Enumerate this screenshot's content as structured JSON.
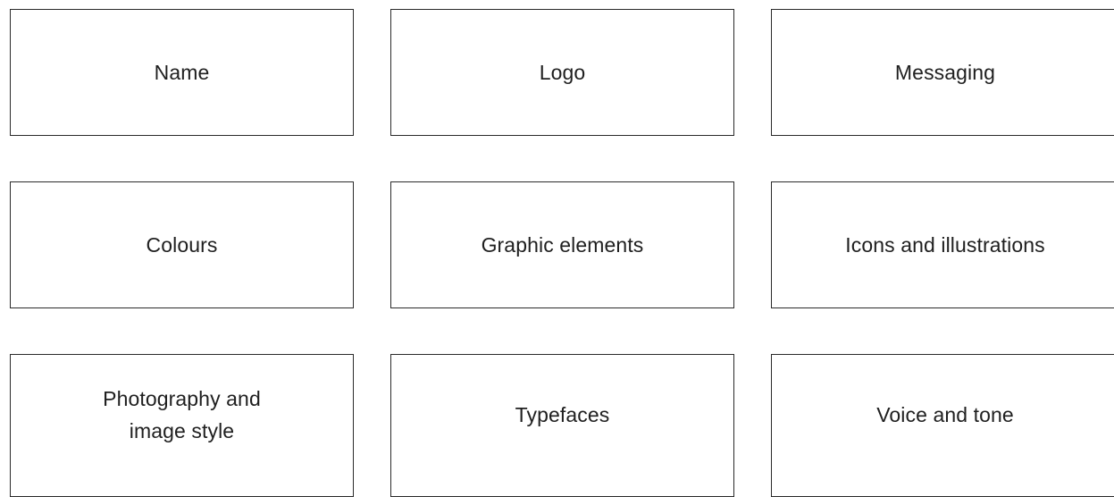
{
  "cards": [
    {
      "label": "Name"
    },
    {
      "label": "Logo"
    },
    {
      "label": "Messaging"
    },
    {
      "label": "Colours"
    },
    {
      "label": "Graphic elements"
    },
    {
      "label": "Icons and illustrations"
    },
    {
      "label": "Photography and\nimage style"
    },
    {
      "label": "Typefaces"
    },
    {
      "label": "Voice and tone"
    }
  ]
}
